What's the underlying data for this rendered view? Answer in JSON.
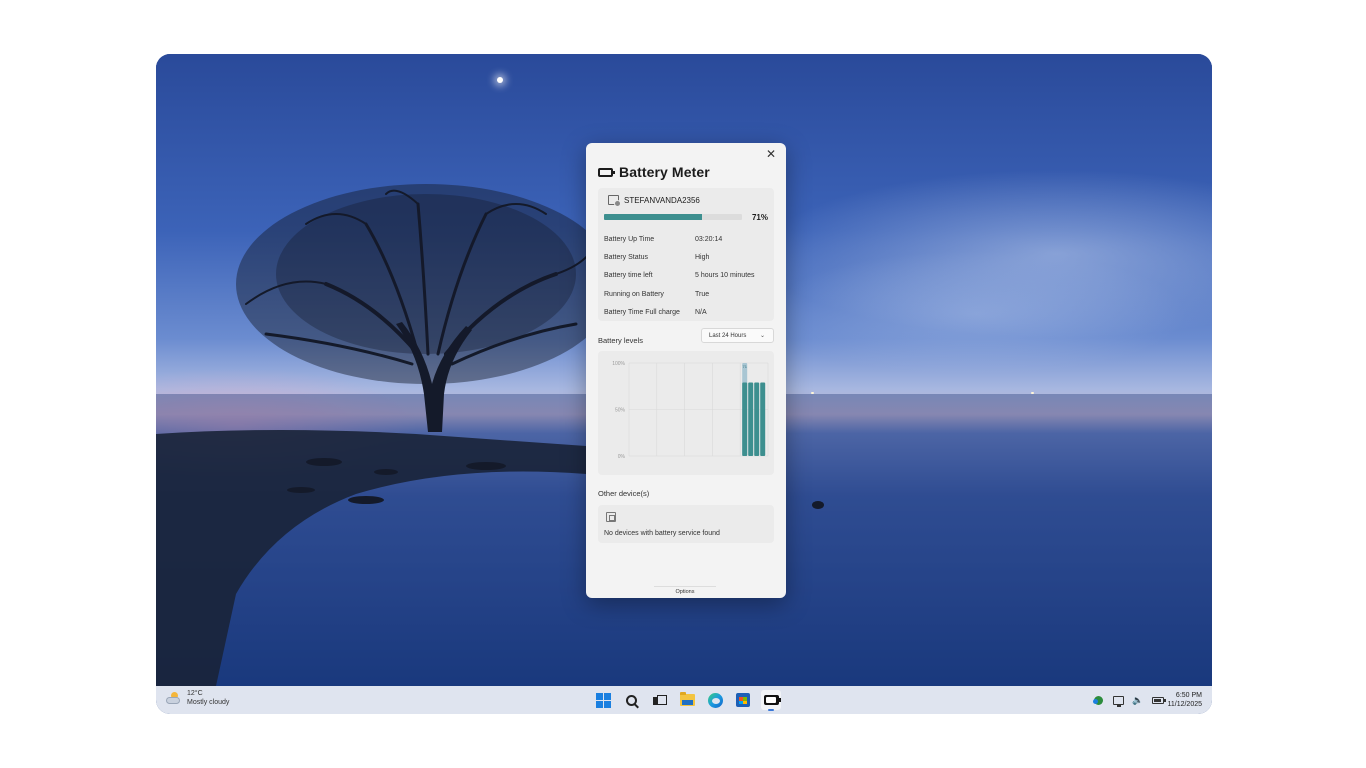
{
  "window": {
    "title": "Battery Meter",
    "close_label": "✕"
  },
  "device": {
    "name": "STEFANVANDA2356",
    "battery_percent": 71,
    "battery_percent_label": "71%",
    "details": [
      {
        "label": "Battery Up Time",
        "value": "03:20:14"
      },
      {
        "label": "Battery Status",
        "value": "High"
      },
      {
        "label": "Battery time left",
        "value": "5 hours 10 minutes"
      },
      {
        "label": "Running on Battery",
        "value": "True"
      },
      {
        "label": "Battery Time Full charge",
        "value": "N/A"
      }
    ]
  },
  "levels": {
    "label": "Battery levels",
    "range_selected": "Last 24 Hours"
  },
  "chart_data": {
    "type": "bar",
    "y_tick_labels": [
      "100%",
      "50%",
      "0%"
    ],
    "x_tick_labels": [
      "",
      "",
      "",
      "",
      "",
      ""
    ],
    "bars": [
      {
        "slot": 0,
        "value": 100
      },
      {
        "slot": 0,
        "value": 79
      },
      {
        "slot": 1,
        "value": 79
      },
      {
        "slot": 2,
        "value": 79
      },
      {
        "slot": 3,
        "value": 79
      }
    ],
    "marker_label": "71",
    "ylim": [
      0,
      100
    ],
    "grid": true,
    "colors": {
      "bar": "#3d8f8f",
      "highlight": "#a9c6d3"
    }
  },
  "other_devices": {
    "label": "Other device(s)",
    "empty_message": "No devices with battery service found"
  },
  "options_label": "Options",
  "taskbar": {
    "weather_temp": "12°C",
    "weather_desc": "Mostly cloudy",
    "apps": [
      {
        "name": "start",
        "icon": "windows-logo-icon"
      },
      {
        "name": "search",
        "icon": "search-icon"
      },
      {
        "name": "task-view",
        "icon": "task-view-icon"
      },
      {
        "name": "file-explorer",
        "icon": "folder-icon"
      },
      {
        "name": "edge",
        "icon": "edge-icon"
      },
      {
        "name": "store",
        "icon": "store-icon"
      },
      {
        "name": "battery-meter",
        "icon": "battery-app-icon",
        "active": true
      }
    ],
    "tray": [
      "defender-icon",
      "network-icon",
      "volume-icon",
      "battery-icon"
    ],
    "time": "6:50 PM",
    "date": "11/12/2025"
  }
}
